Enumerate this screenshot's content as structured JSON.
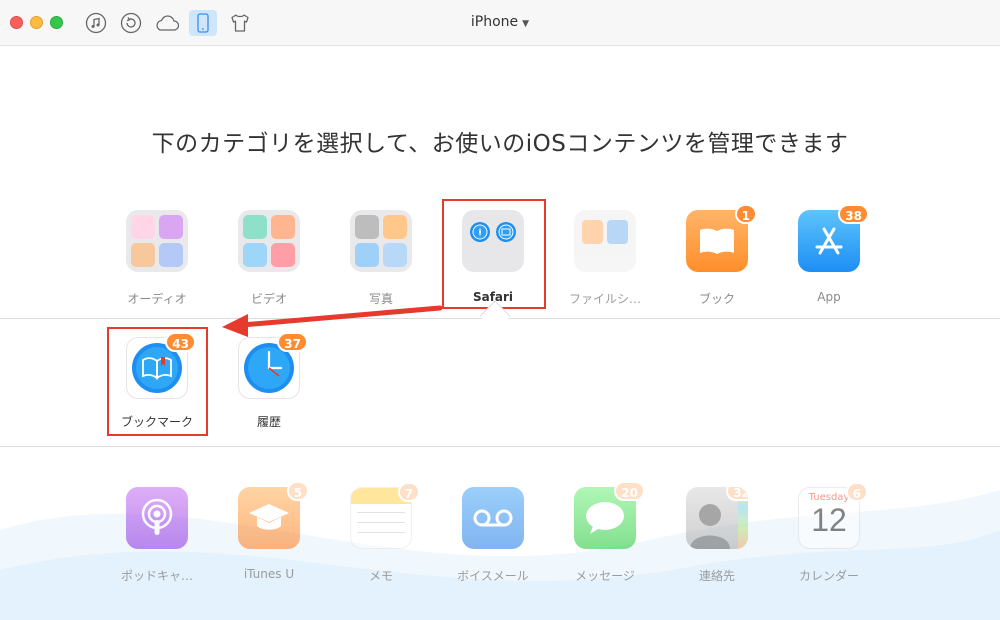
{
  "window": {
    "device_title": "iPhone",
    "toolbar_icons": [
      "music-note-icon",
      "restore-icon",
      "icloud-icon",
      "iphone-icon",
      "tshirt-icon"
    ]
  },
  "headline": "下のカテゴリを選択して、お使いのiOSコンテンツを管理できます",
  "categories_top": [
    {
      "label": "オーディオ",
      "icon": "audio-folder-icon"
    },
    {
      "label": "ビデオ",
      "icon": "video-folder-icon"
    },
    {
      "label": "写真",
      "icon": "photo-folder-icon"
    },
    {
      "label": "Safari",
      "icon": "safari-folder-icon",
      "selected": true
    },
    {
      "label": "ファイルシ…",
      "icon": "file-system-folder-icon"
    },
    {
      "label": "ブック",
      "icon": "books-icon",
      "badge": "1"
    },
    {
      "label": "App",
      "icon": "app-store-icon",
      "badge": "38"
    }
  ],
  "safari_sub": [
    {
      "label": "ブックマーク",
      "icon": "bookmark-icon",
      "badge": "43",
      "highlighted": true
    },
    {
      "label": "履歴",
      "icon": "history-clock-icon",
      "badge": "37"
    }
  ],
  "categories_bottom": [
    {
      "label": "ポッドキャ…",
      "icon": "podcast-icon"
    },
    {
      "label": "iTunes U",
      "icon": "itunes-u-icon",
      "badge": "5"
    },
    {
      "label": "メモ",
      "icon": "notes-icon",
      "badge": "7"
    },
    {
      "label": "ボイスメール",
      "icon": "voicemail-icon"
    },
    {
      "label": "メッセージ",
      "icon": "messages-icon",
      "badge": "20"
    },
    {
      "label": "連絡先",
      "icon": "contacts-icon",
      "badge": "32"
    },
    {
      "label": "カレンダー",
      "icon": "calendar-icon",
      "badge": "6",
      "day_name": "Tuesday",
      "day_number": "12"
    }
  ],
  "colors": {
    "accent": "#ff8b32",
    "highlight_box": "#e53b2c",
    "active_toolbar": "#cfe6fa"
  }
}
